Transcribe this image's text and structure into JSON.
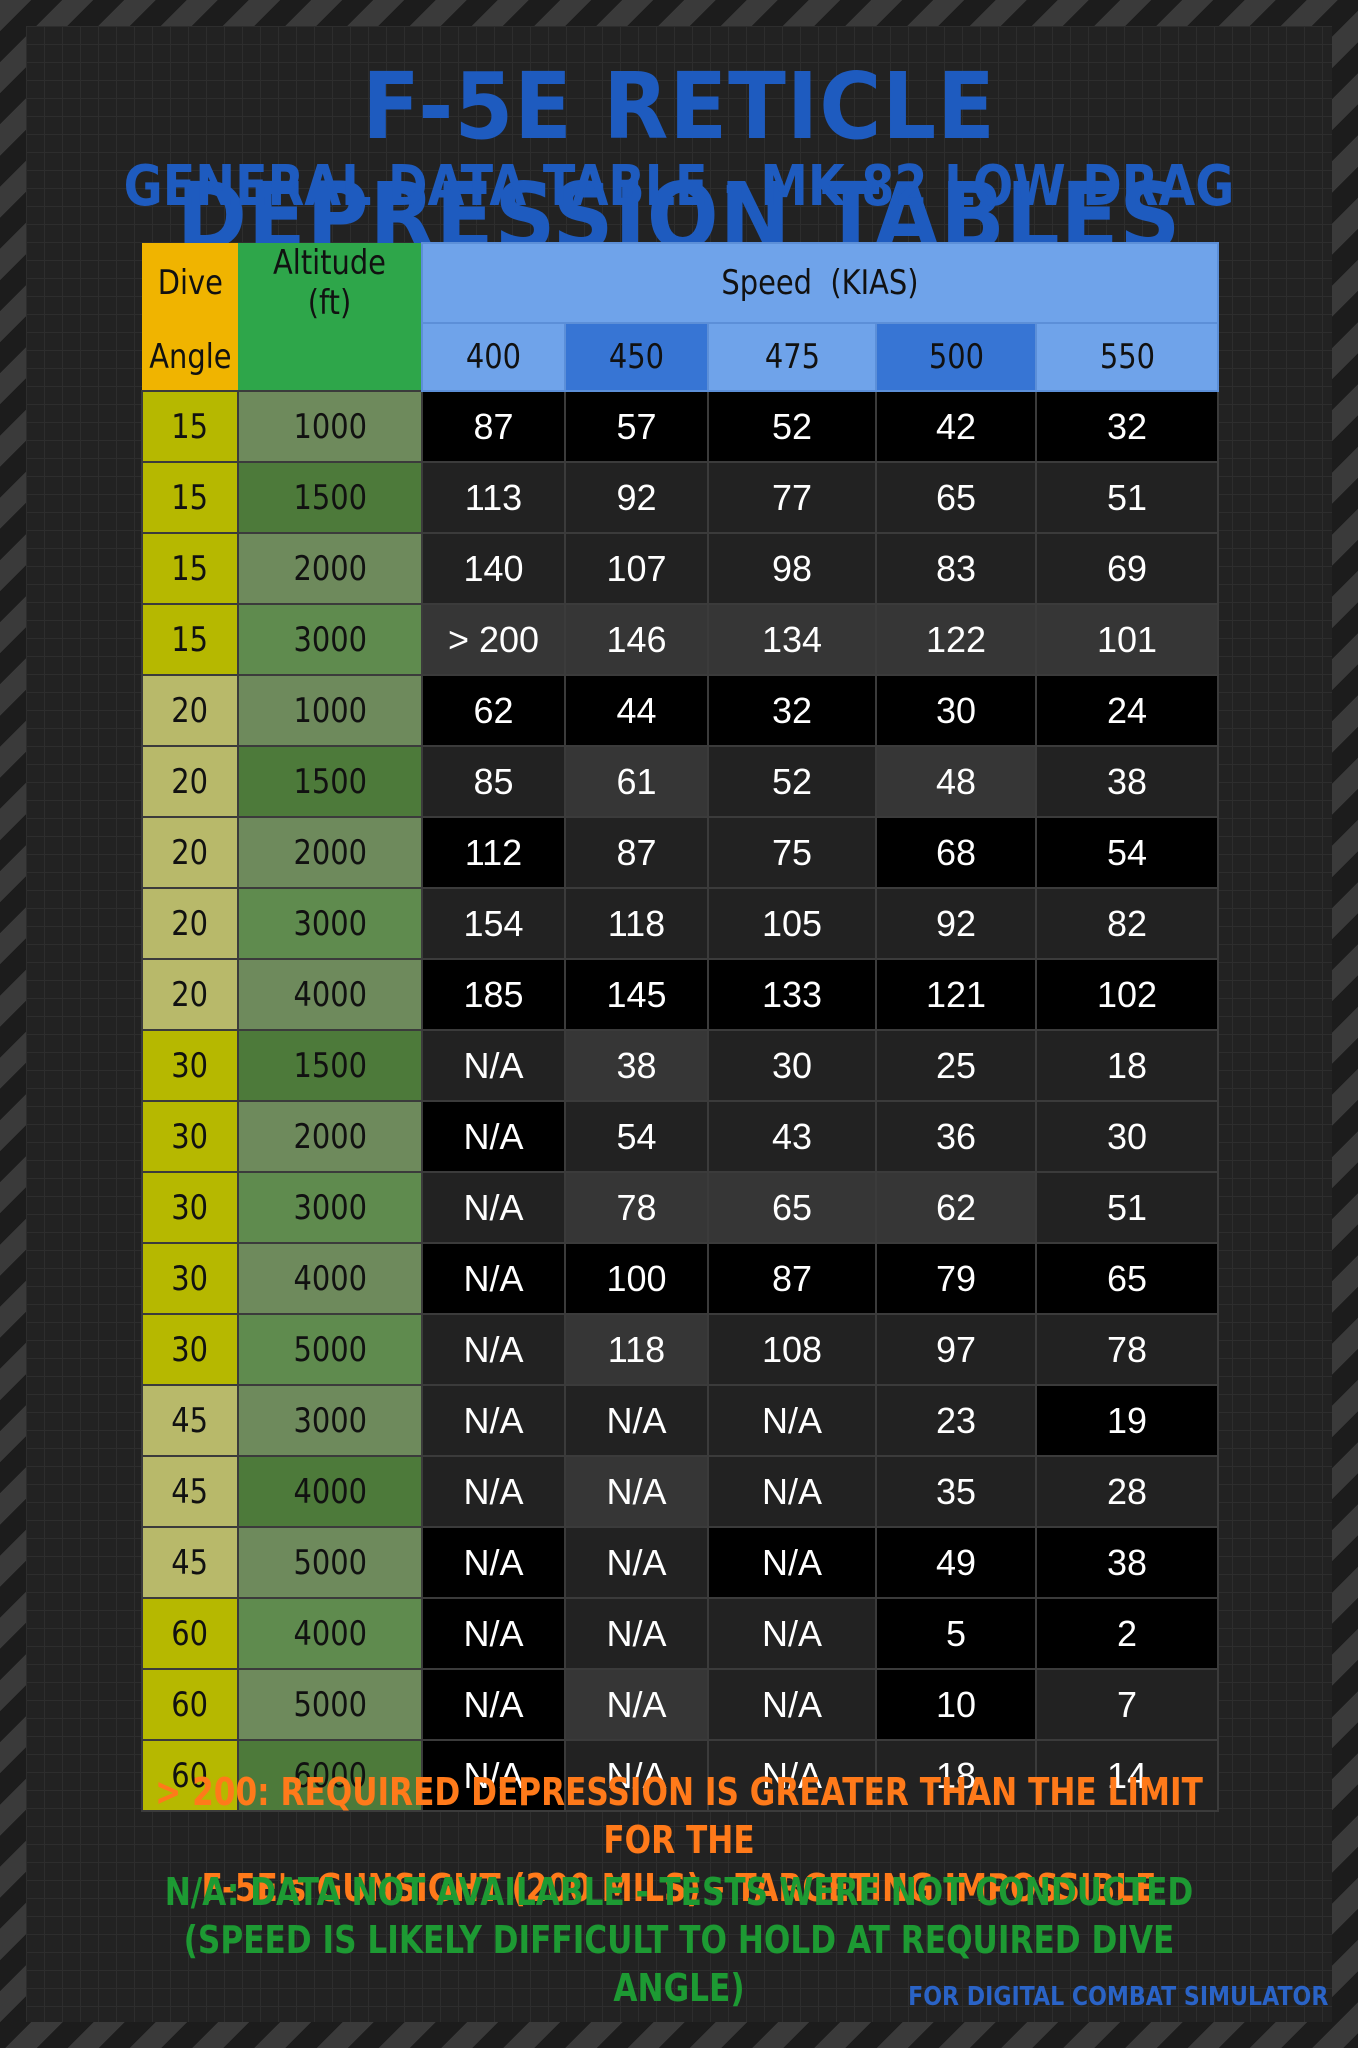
{
  "title": "F-5E RETICLE DEPRESSION TABLES",
  "subtitle": "GENERAL DATA TABLE - MK 82 LOW DRAG",
  "table": {
    "dive_label_1": "Dive",
    "dive_label_2": "Angle",
    "altitude_label": "Altitude (ft)",
    "speed_label": "Speed  (KIAS)",
    "speeds": [
      "400",
      "450",
      "475",
      "500",
      "550"
    ],
    "rows": [
      {
        "dive": "15",
        "alt": "1000",
        "v": [
          "87",
          "57",
          "52",
          "42",
          "32"
        ]
      },
      {
        "dive": "15",
        "alt": "1500",
        "v": [
          "113",
          "92",
          "77",
          "65",
          "51"
        ]
      },
      {
        "dive": "15",
        "alt": "2000",
        "v": [
          "140",
          "107",
          "98",
          "83",
          "69"
        ]
      },
      {
        "dive": "15",
        "alt": "3000",
        "v": [
          "> 200",
          "146",
          "134",
          "122",
          "101"
        ]
      },
      {
        "dive": "20",
        "alt": "1000",
        "v": [
          "62",
          "44",
          "32",
          "30",
          "24"
        ]
      },
      {
        "dive": "20",
        "alt": "1500",
        "v": [
          "85",
          "61",
          "52",
          "48",
          "38"
        ]
      },
      {
        "dive": "20",
        "alt": "2000",
        "v": [
          "112",
          "87",
          "75",
          "68",
          "54"
        ]
      },
      {
        "dive": "20",
        "alt": "3000",
        "v": [
          "154",
          "118",
          "105",
          "92",
          "82"
        ]
      },
      {
        "dive": "20",
        "alt": "4000",
        "v": [
          "185",
          "145",
          "133",
          "121",
          "102"
        ]
      },
      {
        "dive": "30",
        "alt": "1500",
        "v": [
          "N/A",
          "38",
          "30",
          "25",
          "18"
        ]
      },
      {
        "dive": "30",
        "alt": "2000",
        "v": [
          "N/A",
          "54",
          "43",
          "36",
          "30"
        ]
      },
      {
        "dive": "30",
        "alt": "3000",
        "v": [
          "N/A",
          "78",
          "65",
          "62",
          "51"
        ]
      },
      {
        "dive": "30",
        "alt": "4000",
        "v": [
          "N/A",
          "100",
          "87",
          "79",
          "65"
        ]
      },
      {
        "dive": "30",
        "alt": "5000",
        "v": [
          "N/A",
          "118",
          "108",
          "97",
          "78"
        ]
      },
      {
        "dive": "45",
        "alt": "3000",
        "v": [
          "N/A",
          "N/A",
          "N/A",
          "23",
          "19"
        ]
      },
      {
        "dive": "45",
        "alt": "4000",
        "v": [
          "N/A",
          "N/A",
          "N/A",
          "35",
          "28"
        ]
      },
      {
        "dive": "45",
        "alt": "5000",
        "v": [
          "N/A",
          "N/A",
          "N/A",
          "49",
          "38"
        ]
      },
      {
        "dive": "60",
        "alt": "4000",
        "v": [
          "N/A",
          "N/A",
          "N/A",
          "5",
          "2"
        ]
      },
      {
        "dive": "60",
        "alt": "5000",
        "v": [
          "N/A",
          "N/A",
          "N/A",
          "10",
          "7"
        ]
      },
      {
        "dive": "60",
        "alt": "6000",
        "v": [
          "N/A",
          "N/A",
          "N/A",
          "18",
          "14"
        ]
      }
    ]
  },
  "notes": {
    "line1": "> 200: REQUIRED DEPRESSION IS GREATER THAN THE LIMIT FOR THE",
    "line2": "F-5E's GUNSIGHT (200 MILS) - TARGETING IMPOSSIBLE",
    "line3": "N/A: DATA NOT AVAILABLE - TESTS WERE NOT CONDUCTED",
    "line4": "(SPEED IS LIKELY DIFFICULT TO HOLD AT REQUIRED DIVE ANGLE)"
  },
  "footer": "FOR DIGITAL COMBAT SIMULATOR",
  "colors": {
    "title_blue": "#1e5bbf",
    "dive_header": "#f0b400",
    "altitude_header": "#2ea64a",
    "speed_header": "#6fa3ea",
    "note_orange": "#ff7a1a",
    "note_green": "#1d9a33"
  }
}
